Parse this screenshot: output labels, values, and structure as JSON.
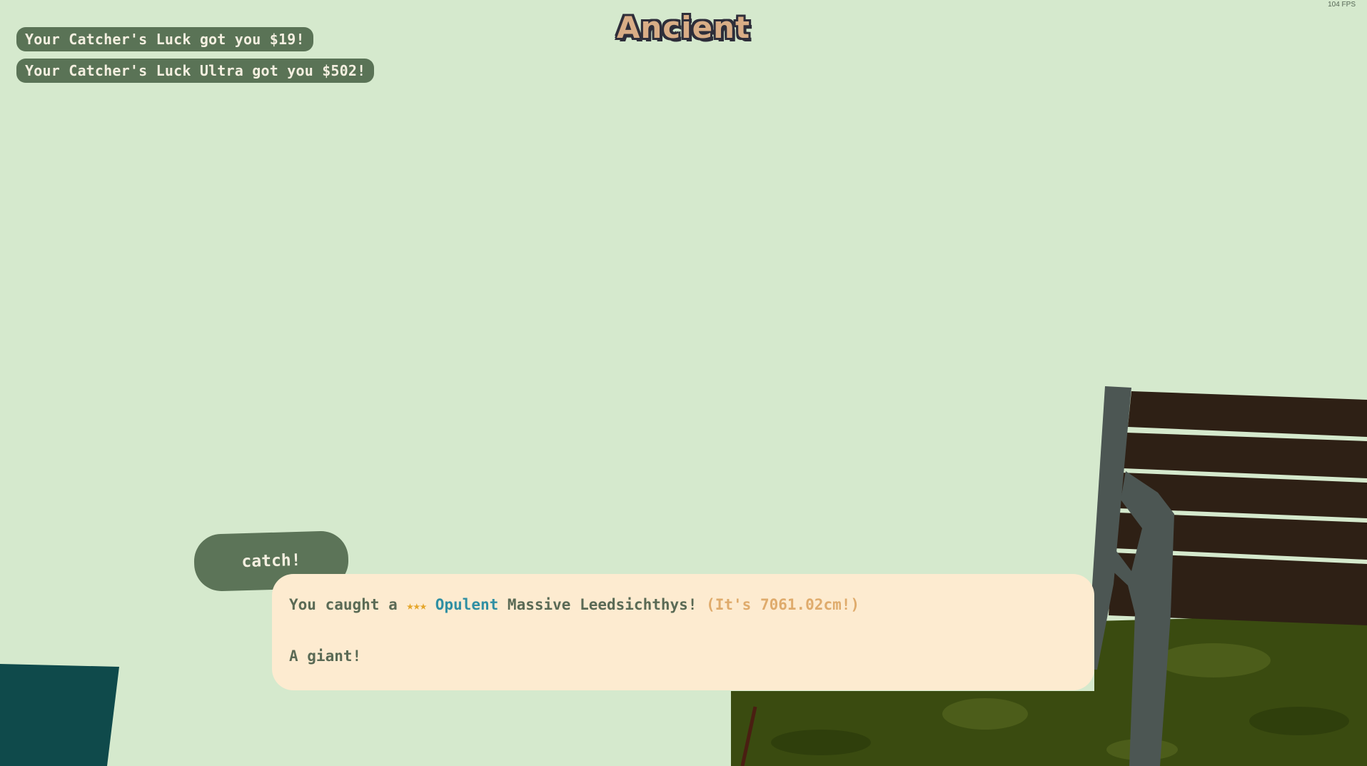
{
  "hud": {
    "fps": "104 FPS",
    "rarity_title": "Ancient"
  },
  "notifications": [
    {
      "text": "Your Catcher's Luck got you $19!"
    },
    {
      "text": "Your Catcher's Luck Ultra got you $502!"
    }
  ],
  "catch_button": {
    "label": "catch!"
  },
  "dialog": {
    "prefix": "You caught a",
    "stars": "★★★",
    "modifier": "Opulent",
    "fish_name": "Massive Leedsichthys!",
    "size_note": "(It's 7061.02cm!)",
    "comment": "A giant!"
  },
  "colors": {
    "background": "#d5e9cd",
    "notification_bg": "#5a7356",
    "dialog_bg": "#fdebd0",
    "star_color": "#e5a62a",
    "modifier_color": "#2f8fa3",
    "size_color": "#dfab6c",
    "rarity_fill": "#d9ad86"
  }
}
